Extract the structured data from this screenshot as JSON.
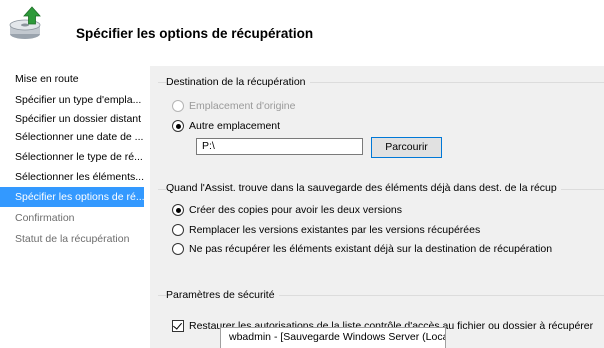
{
  "header": {
    "title": "Spécifier les options de récupération",
    "icon": "backup-restore-icon"
  },
  "sidebar": {
    "items": [
      {
        "label": "Mise en route",
        "state": "normal"
      },
      {
        "label": "Spécifier un type d'empla...",
        "state": "normal"
      },
      {
        "label": "Spécifier un dossier distant",
        "state": "normal"
      },
      {
        "label": "Sélectionner une date de ...",
        "state": "normal"
      },
      {
        "label": "Sélectionner le type de ré...",
        "state": "normal"
      },
      {
        "label": "Sélectionner les éléments...",
        "state": "normal"
      },
      {
        "label": "Spécifier les options de ré...",
        "state": "active"
      },
      {
        "label": "Confirmation",
        "state": "disabled"
      },
      {
        "label": "Statut de la récupération",
        "state": "disabled"
      }
    ]
  },
  "destination": {
    "group_title": "Destination de la récupération",
    "option_original": "Emplacement d'origine",
    "option_other": "Autre emplacement",
    "path_value": "P:\\",
    "browse_label": "Parcourir"
  },
  "conflict": {
    "group_title": "Quand l'Assist. trouve dans la sauvegarde des éléments déjà dans dest. de la récup",
    "option_copies": "Créer des copies pour avoir les deux versions",
    "option_replace": "Remplacer les versions existantes par les versions récupérées",
    "option_skip": "Ne pas récupérer les éléments existant déjà sur la destination de récupération"
  },
  "security": {
    "group_title": "Paramètres de sécurité",
    "restore_acl_label": "Restaurer les autorisations de la liste contrôle d'accès au fichier ou dossier à récupérer",
    "account_text": "wbadmin - [Sauvegarde Windows Server (Local)\\"
  },
  "colors": {
    "accent": "#3399ff",
    "content_background": "#f0f0f0",
    "button_border": "#0078d7"
  }
}
